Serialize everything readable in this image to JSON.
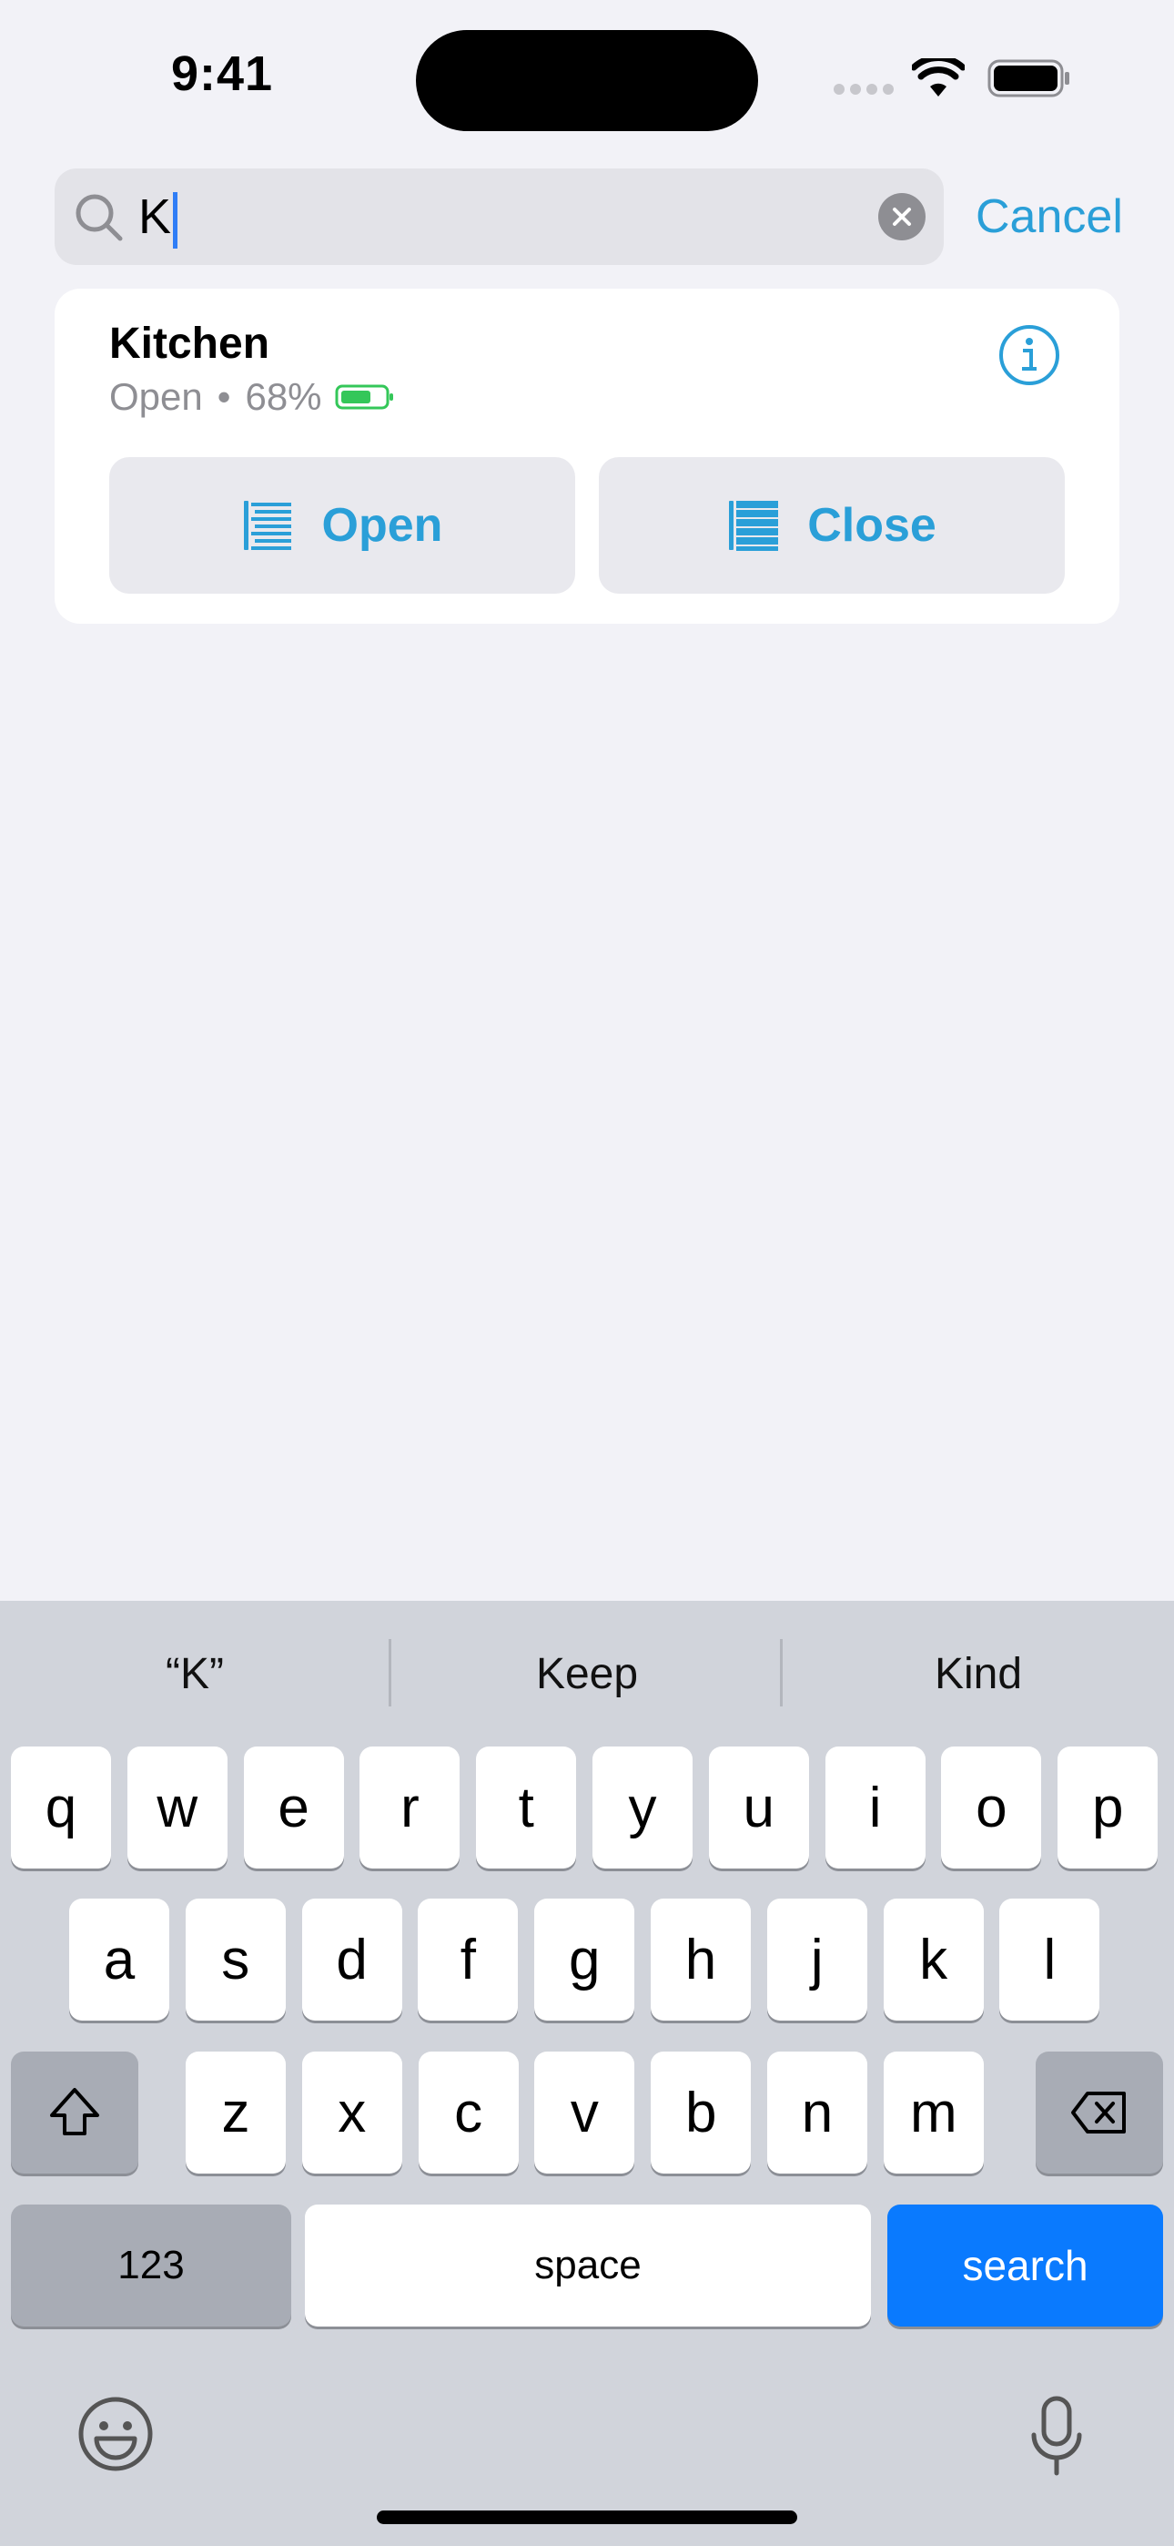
{
  "status_bar": {
    "time": "9:41"
  },
  "search": {
    "value": "K",
    "cancel_label": "Cancel"
  },
  "result": {
    "title": "Kitchen",
    "state": "Open",
    "separator": "•",
    "battery": "68%",
    "open_label": "Open",
    "close_label": "Close"
  },
  "keyboard": {
    "suggestions": [
      "“K”",
      "Keep",
      "Kind"
    ],
    "row1": [
      "q",
      "w",
      "e",
      "r",
      "t",
      "y",
      "u",
      "i",
      "o",
      "p"
    ],
    "row2": [
      "a",
      "s",
      "d",
      "f",
      "g",
      "h",
      "j",
      "k",
      "l"
    ],
    "row3": [
      "z",
      "x",
      "c",
      "v",
      "b",
      "n",
      "m"
    ],
    "numbers_label": "123",
    "space_label": "space",
    "search_label": "search"
  },
  "colors": {
    "accent": "#2a9fd8",
    "search_key": "#0a7afe",
    "battery_green": "#34c759"
  }
}
